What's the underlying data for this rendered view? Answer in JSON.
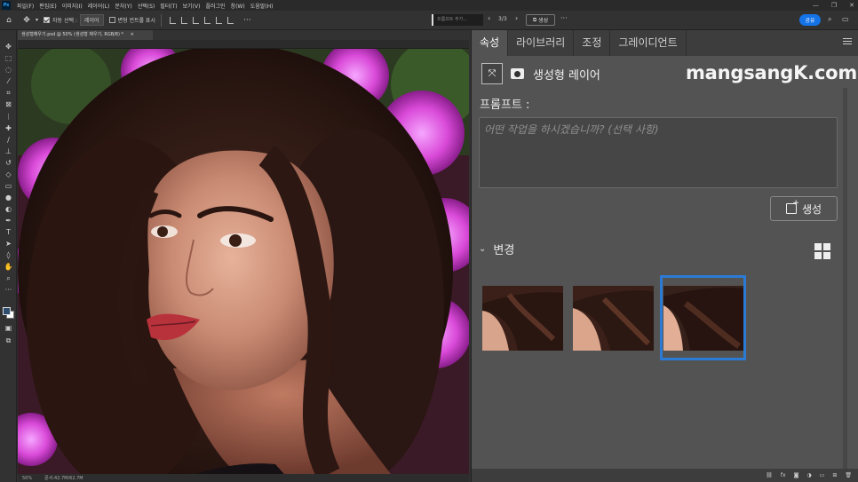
{
  "app": {
    "logo": "Ps",
    "menu": [
      "파일(F)",
      "편집(E)",
      "이미지(I)",
      "레이어(L)",
      "문자(Y)",
      "선택(S)",
      "필터(T)",
      "보기(V)",
      "플러그인",
      "창(W)",
      "도움말(H)"
    ],
    "window_controls": [
      "—",
      "❐",
      "✕"
    ]
  },
  "options": {
    "auto_select_label": "자동 선택 :",
    "auto_select_value": "레이어",
    "transform_label": "변형 컨트롤 표시",
    "more": "···",
    "prompt_placeholder": "프롬프트 추가...",
    "prev": "‹",
    "counter": "3/3",
    "next": "›",
    "generate": "생성",
    "more2": "···",
    "share": "공유"
  },
  "document": {
    "tab_title": "생성형채우기.psd @ 50% (생성형 채우기, RGB/8) *",
    "close": "×",
    "zoom": "50%",
    "doc_info": "문서:42.7M/62.7M"
  },
  "panel": {
    "tabs": [
      "속성",
      "라이브러리",
      "조정",
      "그레이디언트"
    ],
    "active_tab": 0,
    "layer_type": "생성형 레이어",
    "watermark": "mangsangK.com",
    "prompt_label": "프롬프트 :",
    "prompt_placeholder": "어떤 작업을 하시겠습니까? (선택 사항)",
    "generate_label": "생성",
    "variations_label": "변경",
    "selected_variation": 2,
    "variation_count": 3
  },
  "colors": {
    "accent": "#2b7bd6",
    "share": "#1473e6",
    "panel_bg": "#535353"
  },
  "icons": [
    "move-icon",
    "marquee-icon",
    "lasso-icon",
    "magic-wand-icon",
    "crop-icon",
    "frame-icon",
    "eyedropper-icon",
    "healing-icon",
    "brush-icon",
    "stamp-icon",
    "history-brush-icon",
    "eraser-icon",
    "gradient-icon",
    "blur-icon",
    "dodge-icon",
    "pen-icon",
    "type-icon",
    "path-select-icon",
    "shape-icon",
    "hand-icon",
    "zoom-icon",
    "more-tools-icon"
  ]
}
